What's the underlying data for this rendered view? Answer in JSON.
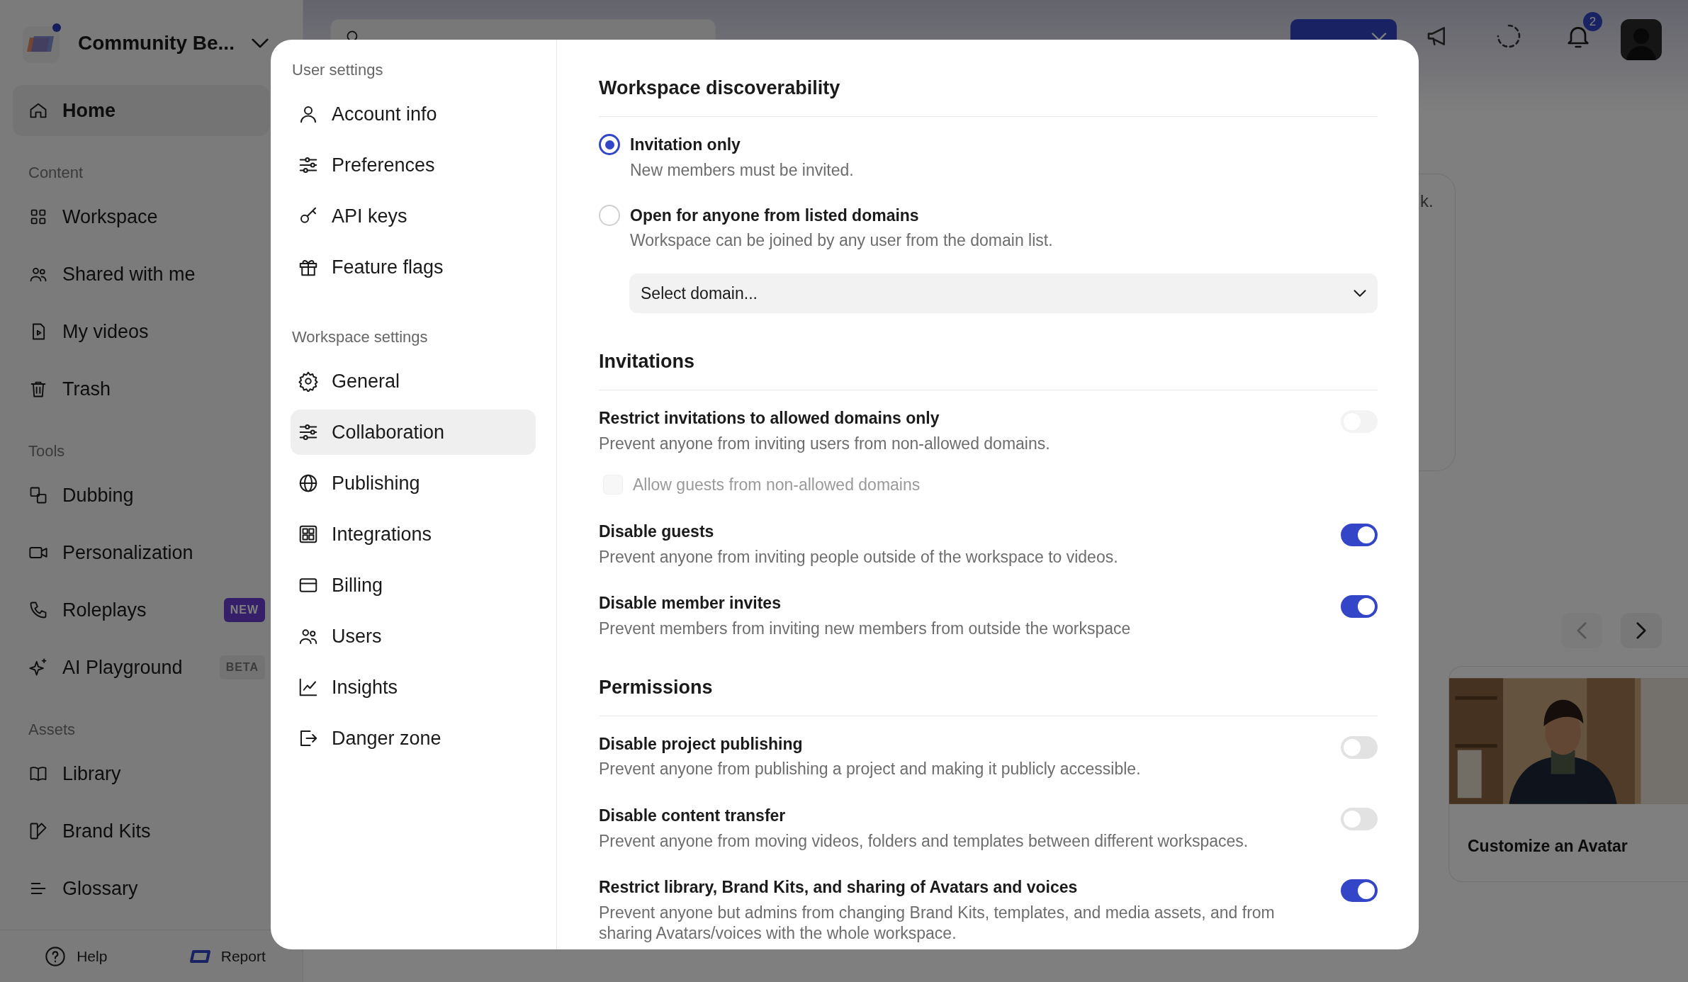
{
  "workspace": {
    "name": "Community Be..."
  },
  "sidebar": {
    "sections": [
      {
        "items": [
          {
            "label": "Home",
            "selected": true
          }
        ]
      },
      {
        "title": "Content",
        "items": [
          {
            "label": "Workspace",
            "selected": false
          },
          {
            "label": "Shared with me",
            "selected": false
          },
          {
            "label": "My videos",
            "selected": false
          },
          {
            "label": "Trash",
            "selected": false
          }
        ]
      },
      {
        "title": "Tools",
        "items": [
          {
            "label": "Dubbing",
            "selected": false
          },
          {
            "label": "Personalization",
            "selected": false
          },
          {
            "label": "Roleplays",
            "selected": false,
            "badge": {
              "text": "NEW",
              "kind": "new"
            }
          },
          {
            "label": "AI Playground",
            "selected": false,
            "badge": {
              "text": "BETA",
              "kind": "beta"
            }
          }
        ]
      },
      {
        "title": "Assets",
        "items": [
          {
            "label": "Library",
            "selected": false
          },
          {
            "label": "Brand Kits",
            "selected": false
          },
          {
            "label": "Glossary",
            "selected": false
          }
        ]
      }
    ]
  },
  "footer": [
    {
      "label": "Help"
    },
    {
      "label": "Report"
    }
  ],
  "topbar": {
    "notifications": "2"
  },
  "background_card": {
    "text": "k."
  },
  "carousel": {
    "cards": [
      {
        "kind": "picture",
        "title": "Customize an Avatar"
      }
    ]
  },
  "settings": {
    "nav": [
      {
        "title": "User settings",
        "items": [
          {
            "label": "Account info",
            "selected": false
          },
          {
            "label": "Preferences",
            "selected": false
          },
          {
            "label": "API keys",
            "selected": false
          },
          {
            "label": "Feature flags",
            "selected": false
          }
        ]
      },
      {
        "title": "Workspace settings",
        "items": [
          {
            "label": "General",
            "selected": false
          },
          {
            "label": "Collaboration",
            "selected": true
          },
          {
            "label": "Publishing",
            "selected": false
          },
          {
            "label": "Integrations",
            "selected": false
          },
          {
            "label": "Billing",
            "selected": false
          },
          {
            "label": "Users",
            "selected": false
          },
          {
            "label": "Insights",
            "selected": false
          },
          {
            "label": "Danger zone",
            "selected": false
          }
        ]
      }
    ],
    "sections": [
      {
        "title": "Workspace discoverability",
        "rows": [
          {
            "kind": "radio",
            "title": "Invitation only",
            "description": "New members must be invited.",
            "selected": true
          },
          {
            "kind": "radio",
            "title": "Open for anyone from listed domains",
            "description": "Workspace can be joined by any user from the domain list.",
            "selected": false
          },
          {
            "kind": "select",
            "placeholder": "Select domain..."
          }
        ]
      },
      {
        "title": "Invitations",
        "rows": [
          {
            "kind": "toggle",
            "title": "Restrict invitations to allowed domains only",
            "description": "Prevent anyone from inviting users from non-allowed domains.",
            "on": false,
            "disabled": true
          },
          {
            "kind": "checkbox",
            "title": "Allow guests from non-allowed domains",
            "checked": false,
            "disabled": true
          },
          {
            "kind": "toggle",
            "title": "Disable guests",
            "description": "Prevent anyone from inviting people outside of the workspace to videos.",
            "on": true,
            "disabled": false
          },
          {
            "kind": "toggle",
            "title": "Disable member invites",
            "description": "Prevent members from inviting new members from outside the workspace",
            "on": true,
            "disabled": false
          }
        ]
      },
      {
        "title": "Permissions",
        "rows": [
          {
            "kind": "toggle",
            "title": "Disable project publishing",
            "description": "Prevent anyone from publishing a project and making it publicly accessible.",
            "on": false,
            "disabled": false
          },
          {
            "kind": "toggle",
            "title": "Disable content transfer",
            "description": "Prevent anyone from moving videos, folders and templates between different workspaces.",
            "on": false,
            "disabled": false
          },
          {
            "kind": "toggle",
            "title": "Restrict library, Brand Kits, and sharing of Avatars and voices",
            "description": "Prevent anyone but admins from changing Brand Kits, templates, and media assets, and from sharing Avatars/voices with the whole workspace.",
            "on": true,
            "disabled": false
          }
        ]
      }
    ]
  }
}
